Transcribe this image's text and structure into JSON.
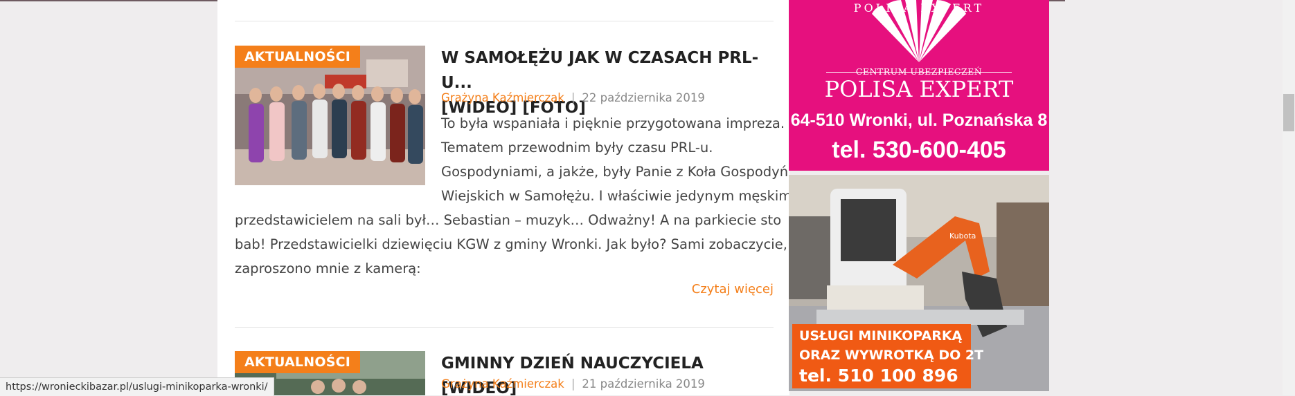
{
  "articles": [
    {
      "category": "AKTUALNOŚCI",
      "title_line1": "W SAMOŁĘŻU JAK W CZASACH PRL-U...",
      "title_line2": "[WIDEO] [FOTO]",
      "author": "Grażyna Kaźmierczak",
      "separator": "|",
      "date": "22 października 2019",
      "excerpt_lines": [
        "To była wspaniała i pięknie przygotowana impreza.",
        "Tematem przewodnim były czasu PRL-u.",
        "Gospodyniami, a jakże, były Panie z Koła Gospodyń",
        "Wiejskich w Samołężu. I właściwie jedynym męskim",
        "przedstawicielem na sali był… Sebastian – muzyk… Odważny! A na parkiecie sto",
        "bab! Przedstawicielki dziewięciu KGW z gminy Wronki. Jak było? Sami zobaczycie, bo",
        "zaproszono mnie z kamerą:"
      ],
      "read_more": "Czytaj więcej"
    },
    {
      "category": "AKTUALNOŚCI",
      "title_line1": "GMINNY DZIEŃ NAUCZYCIELA [WIDEO]",
      "author": "Grażyna Kaźmierczak",
      "separator": "|",
      "date": "21 października 2019"
    }
  ],
  "ads": {
    "insurance": {
      "brand_arc": "POLISA EXPERT",
      "subtitle": "CENTRUM UBEZPIECZEŃ",
      "name": "POLISA EXPERT",
      "address": "64-510 Wronki, ul. Poznańska 8",
      "phone": "tel. 530-600-405"
    },
    "excavator": {
      "line1": "USŁUGI MINIKOPARKĄ",
      "line2": "ORAZ WYWROTKĄ DO 2T",
      "phone": "tel. 510 100 896",
      "machine_brand": "Kubota"
    }
  },
  "status_bar": {
    "url": "https://wronieckibazar.pl/uslugi-minikoparka-wronki/"
  },
  "colors": {
    "accent": "#f47f1a",
    "insurance_bg": "#e6107e",
    "excavator_box": "#f05a14"
  }
}
